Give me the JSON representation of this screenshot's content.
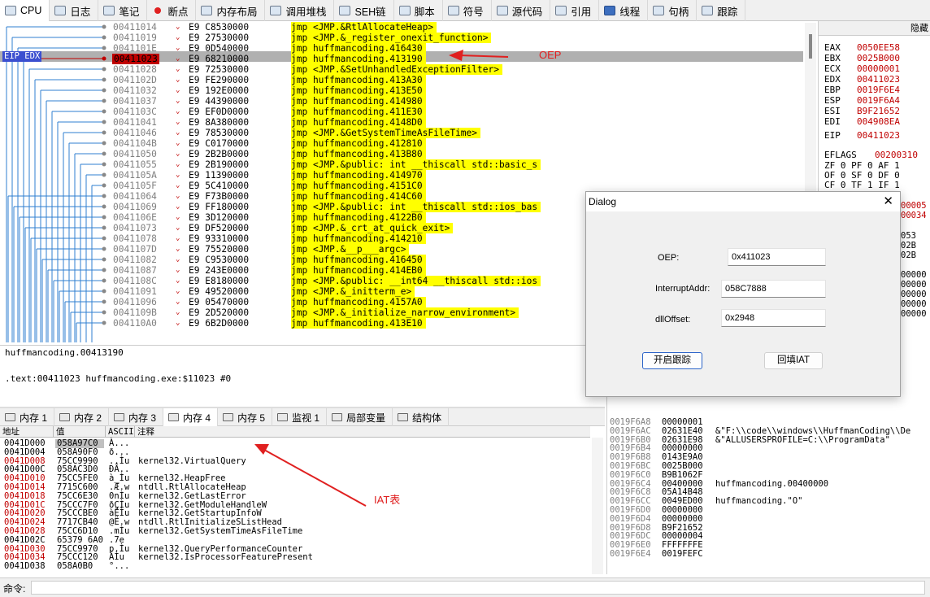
{
  "tabs": [
    {
      "label": "CPU",
      "icon": "cpu-icon"
    },
    {
      "label": "日志",
      "icon": "log-icon"
    },
    {
      "label": "笔记",
      "icon": "notes-icon"
    },
    {
      "label": "断点",
      "icon": "breakpoint-icon"
    },
    {
      "label": "内存布局",
      "icon": "memory-map-icon"
    },
    {
      "label": "调用堆栈",
      "icon": "call-stack-icon"
    },
    {
      "label": "SEH链",
      "icon": "seh-icon"
    },
    {
      "label": "脚本",
      "icon": "script-icon"
    },
    {
      "label": "符号",
      "icon": "symbol-icon"
    },
    {
      "label": "源代码",
      "icon": "source-icon"
    },
    {
      "label": "引用",
      "icon": "references-icon"
    },
    {
      "label": "线程",
      "icon": "threads-icon"
    },
    {
      "label": "句柄",
      "icon": "handles-icon"
    },
    {
      "label": "跟踪",
      "icon": "trace-icon"
    }
  ],
  "disasm": [
    {
      "addr": "00411014",
      "bytes": "E9 C8530000",
      "text": "jmp <JMP.&RtlAllocateHeap>"
    },
    {
      "addr": "00411019",
      "bytes": "E9 27530000",
      "text": "jmp <JMP.&_register_onexit_function>"
    },
    {
      "addr": "0041101E",
      "bytes": "E9 0D540000",
      "text": "jmp huffmancoding.416430"
    },
    {
      "addr": "00411023",
      "bytes": "E9 68210000",
      "text": "jmp huffmancoding.413190",
      "current": true
    },
    {
      "addr": "00411028",
      "bytes": "E9 72530000",
      "text": "jmp <JMP.&SetUnhandledExceptionFilter>"
    },
    {
      "addr": "0041102D",
      "bytes": "E9 FE290000",
      "text": "jmp huffmancoding.413A30"
    },
    {
      "addr": "00411032",
      "bytes": "E9 192E0000",
      "text": "jmp huffmancoding.413E50"
    },
    {
      "addr": "00411037",
      "bytes": "E9 44390000",
      "text": "jmp huffmancoding.414980"
    },
    {
      "addr": "0041103C",
      "bytes": "E9 EF0D0000",
      "text": "jmp huffmancoding.411E30"
    },
    {
      "addr": "00411041",
      "bytes": "E9 8A380000",
      "text": "jmp huffmancoding.4148D0"
    },
    {
      "addr": "00411046",
      "bytes": "E9 78530000",
      "text": "jmp <JMP.&GetSystemTimeAsFileTime>"
    },
    {
      "addr": "0041104B",
      "bytes": "E9 C0170000",
      "text": "jmp huffmancoding.412810"
    },
    {
      "addr": "00411050",
      "bytes": "E9 2B2B0000",
      "text": "jmp huffmancoding.413B80"
    },
    {
      "addr": "00411055",
      "bytes": "E9 2B190000",
      "text": "jmp <JMP.&public: int __thiscall std::basic_s"
    },
    {
      "addr": "0041105A",
      "bytes": "E9 11390000",
      "text": "jmp huffmancoding.414970"
    },
    {
      "addr": "0041105F",
      "bytes": "E9 5C410000",
      "text": "jmp huffmancoding.4151C0"
    },
    {
      "addr": "00411064",
      "bytes": "E9 F73B0000",
      "text": "jmp huffmancoding.414C60"
    },
    {
      "addr": "00411069",
      "bytes": "E9 FF180000",
      "text": "jmp <JMP.&public: int __thiscall std::ios_bas"
    },
    {
      "addr": "0041106E",
      "bytes": "E9 3D120000",
      "text": "jmp huffmancoding.4122B0"
    },
    {
      "addr": "00411073",
      "bytes": "E9 DF520000",
      "text": "jmp <JMP.&_crt_at_quick_exit>"
    },
    {
      "addr": "00411078",
      "bytes": "E9 93310000",
      "text": "jmp huffmancoding.414210"
    },
    {
      "addr": "0041107D",
      "bytes": "E9 75520000",
      "text": "jmp <JMP.&__p___argc>"
    },
    {
      "addr": "00411082",
      "bytes": "E9 C9530000",
      "text": "jmp huffmancoding.416450"
    },
    {
      "addr": "00411087",
      "bytes": "E9 243E0000",
      "text": "jmp huffmancoding.414EB0"
    },
    {
      "addr": "0041108C",
      "bytes": "E9 E8180000",
      "text": "jmp <JMP.&public: __int64 __thiscall std::ios"
    },
    {
      "addr": "00411091",
      "bytes": "E9 49520000",
      "text": "jmp <JMP.&_initterm_e>"
    },
    {
      "addr": "00411096",
      "bytes": "E9 05470000",
      "text": "jmp huffmancoding.4157A0"
    },
    {
      "addr": "0041109B",
      "bytes": "E9 2D520000",
      "text": "jmp <JMP.&_initialize_narrow_environment>"
    },
    {
      "addr": "004110A0",
      "bytes": "E9 6B2D0000",
      "text": "jmp huffmancoding.413E10"
    }
  ],
  "eip_label": "EIP EDX",
  "registers": {
    "header": "隐藏",
    "rows": [
      {
        "name": "EAX",
        "value": "0050EE58"
      },
      {
        "name": "EBX",
        "value": "0025B000"
      },
      {
        "name": "ECX",
        "value": "00000001"
      },
      {
        "name": "EDX",
        "value": "00411023"
      },
      {
        "name": "EBP",
        "value": "0019F6E4"
      },
      {
        "name": "ESP",
        "value": "0019F6A4"
      },
      {
        "name": "ESI",
        "value": "B9F21652"
      },
      {
        "name": "EDI",
        "value": "004908EA"
      }
    ],
    "eip": {
      "name": "EIP",
      "value": "00411023"
    },
    "eflags": {
      "name": "EFLAGS",
      "value": "00200310"
    },
    "flags": [
      "ZF 0  PF 0  AF 1",
      "OF 0  SF 0  DF 0",
      "CF 0  TF 1  IF 1"
    ],
    "partial_right": [
      "00005",
      "00034",
      "053",
      "02B",
      "02B",
      "00000",
      "00000",
      "00000",
      "00000",
      "00000",
      "00001",
      "31E40",
      "31E98",
      "00000",
      "43E9A"
    ]
  },
  "info": {
    "line1": "huffmancoding.00413190",
    "line2": ".text:00411023 huffmancoding.exe:$11023 #0"
  },
  "memtabs": [
    {
      "label": "内存 1",
      "icon": "memory-icon"
    },
    {
      "label": "内存 2",
      "icon": "memory-icon"
    },
    {
      "label": "内存 3",
      "icon": "memory-icon"
    },
    {
      "label": "内存 4",
      "icon": "memory-icon"
    },
    {
      "label": "内存 5",
      "icon": "memory-icon"
    },
    {
      "label": "监视 1",
      "icon": "watch-icon"
    },
    {
      "label": "局部变量",
      "icon": "locals-icon"
    },
    {
      "label": "结构体",
      "icon": "struct-icon"
    }
  ],
  "memhdr": {
    "addr": "地址",
    "val": "值",
    "ascii": "ASCII",
    "comment": "注释"
  },
  "memrows": [
    {
      "a": "0041D000",
      "h": "058A97C0",
      "s": "À...",
      "c": ""
    },
    {
      "a": "0041D004",
      "h": "058A90F0",
      "s": "ð...",
      "c": ""
    },
    {
      "a": "0041D008",
      "h": "75CC9990",
      "s": "..Ìu",
      "c": "kernel32.VirtualQuery",
      "red": true
    },
    {
      "a": "0041D00C",
      "h": "058AC3D0",
      "s": "ÐÃ..",
      "c": ""
    },
    {
      "a": "0041D010",
      "h": "75CC5FE0",
      "s": "à_Ìu",
      "c": "kernel32.HeapFree",
      "red": true
    },
    {
      "a": "0041D014",
      "h": "7715C600",
      "s": ".Æ.w",
      "c": "ntdll.RtlAllocateHeap",
      "red": true
    },
    {
      "a": "0041D018",
      "h": "75CC6E30",
      "s": "0nÌu",
      "c": "kernel32.GetLastError",
      "red": true
    },
    {
      "a": "0041D01C",
      "h": "75CCC7F0",
      "s": "ðÇÌu",
      "c": "kernel32.GetModuleHandleW",
      "red": true
    },
    {
      "a": "0041D020",
      "h": "75CCCBE0",
      "s": "àËÌu",
      "c": "kernel32.GetStartupInfoW",
      "red": true
    },
    {
      "a": "0041D024",
      "h": "7717CB40",
      "s": "@Ë.w",
      "c": "ntdll.RtlInitializeSListHead",
      "red": true
    },
    {
      "a": "0041D028",
      "h": "75CC6D10",
      "s": ".mÌu",
      "c": "kernel32.GetSystemTimeAsFileTime",
      "red": true
    },
    {
      "a": "0041D02C",
      "h": "65379 6A0",
      "s": " .7e",
      "c": ""
    },
    {
      "a": "0041D030",
      "h": "75CC9970",
      "s": "p.Ìu",
      "c": "kernel32.QueryPerformanceCounter",
      "red": true
    },
    {
      "a": "0041D034",
      "h": "75CCC120",
      "s": " ÁÌu",
      "c": "kernel32.IsProcessorFeaturePresent",
      "red": true
    },
    {
      "a": "0041D038",
      "h": "058A0B0",
      "s": "°...",
      "c": ""
    }
  ],
  "stack": [
    {
      "a": "0019F6A8",
      "v": "00000001",
      "c": ""
    },
    {
      "a": "0019F6AC",
      "v": "02631E40",
      "c": "&\"F:\\\\code\\\\windows\\\\HuffmanCoding\\\\De"
    },
    {
      "a": "0019F6B0",
      "v": "02631E98",
      "c": "&\"ALLUSERSPROFILE=C:\\\\ProgramData\""
    },
    {
      "a": "0019F6B4",
      "v": "00000000",
      "c": ""
    },
    {
      "a": "0019F6B8",
      "v": "0143E9A0",
      "c": ""
    },
    {
      "a": "0019F6BC",
      "v": "0025B000",
      "c": ""
    },
    {
      "a": "0019F6C0",
      "v": "B9B1062F",
      "c": ""
    },
    {
      "a": "0019F6C4",
      "v": "00400000",
      "c": "huffmancoding.00400000"
    },
    {
      "a": "0019F6C8",
      "v": "05A14B48",
      "c": ""
    },
    {
      "a": "0019F6CC",
      "v": "0049ED00",
      "c": "huffmancoding.\"O\""
    },
    {
      "a": "0019F6D0",
      "v": "00000000",
      "c": ""
    },
    {
      "a": "0019F6D4",
      "v": "00000000",
      "c": ""
    },
    {
      "a": "0019F6D8",
      "v": "B9F21652",
      "c": ""
    },
    {
      "a": "0019F6DC",
      "v": "00000004",
      "c": ""
    },
    {
      "a": "0019F6E0",
      "v": "FFFFFFFE",
      "c": ""
    },
    {
      "a": "0019F6E4",
      "v": "0019FEFC",
      "c": ""
    }
  ],
  "cmd_label": "命令:",
  "annotations": {
    "oep": "OEP",
    "iat": "IAT表"
  },
  "dialog": {
    "title": "Dialog",
    "oep_label": "OEP:",
    "oep_value": "0x411023",
    "int_label": "InterruptAddr:",
    "int_value": "058C7888",
    "dll_label": "dllOffset:",
    "dll_value": "0x2948",
    "start_btn": "开启跟踪",
    "iat_btn": "回填IAT"
  },
  "colors": {
    "highlight": "#ffff00",
    "red": "#c00000",
    "arrow": "#e02020",
    "eip": "#3b4fd0"
  }
}
